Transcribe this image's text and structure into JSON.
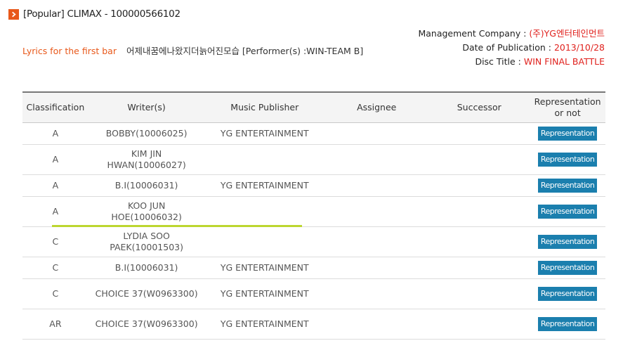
{
  "header": {
    "title": "[Popular] CLIMAX - 100000566102"
  },
  "lyrics": {
    "label": "Lyrics for the first bar",
    "value": "어제내꿈에나왔지더늙어진모습 [Performer(s) :WIN-TEAM B]"
  },
  "meta": {
    "management_label": "Management Company : ",
    "management_value": "(주)YG엔터테인먼트",
    "date_label": "Date of Publication : ",
    "date_value": "2013/10/28",
    "disc_label": "Disc Title : ",
    "disc_value": "WIN FINAL BATTLE"
  },
  "table": {
    "headers": {
      "classification": "Classification",
      "writers": "Writer(s)",
      "publisher": "Music Publisher",
      "assignee": "Assignee",
      "successor": "Successor",
      "representation": "Representation or not"
    },
    "rep_label": "Representation",
    "rows": [
      {
        "classification": "A",
        "writer": "BOBBY(10006025)",
        "publisher": "YG ENTERTAINMENT",
        "assignee": "",
        "successor": ""
      },
      {
        "classification": "A",
        "writer": "KIM JIN HWAN(10006027)",
        "publisher": "",
        "assignee": "",
        "successor": ""
      },
      {
        "classification": "A",
        "writer": "B.I(10006031)",
        "publisher": "YG ENTERTAINMENT",
        "assignee": "",
        "successor": ""
      },
      {
        "classification": "A",
        "writer": "KOO JUN HOE(10006032)",
        "publisher": "",
        "assignee": "",
        "successor": ""
      },
      {
        "classification": "C",
        "writer": "LYDIA SOO PAEK(10001503)",
        "publisher": "",
        "assignee": "",
        "successor": ""
      },
      {
        "classification": "C",
        "writer": "B.I(10006031)",
        "publisher": "YG ENTERTAINMENT",
        "assignee": "",
        "successor": ""
      },
      {
        "classification": "C",
        "writer": "CHOICE 37(W0963300)",
        "publisher": "YG ENTERTAINMENT",
        "assignee": "",
        "successor": ""
      },
      {
        "classification": "AR",
        "writer": "CHOICE 37(W0963300)",
        "publisher": "YG ENTERTAINMENT",
        "assignee": "",
        "successor": ""
      }
    ]
  },
  "colors": {
    "accent": "#e8581a",
    "value_red": "#e0211d",
    "button_blue": "#1b7fae",
    "highlight": "#bcd630"
  }
}
